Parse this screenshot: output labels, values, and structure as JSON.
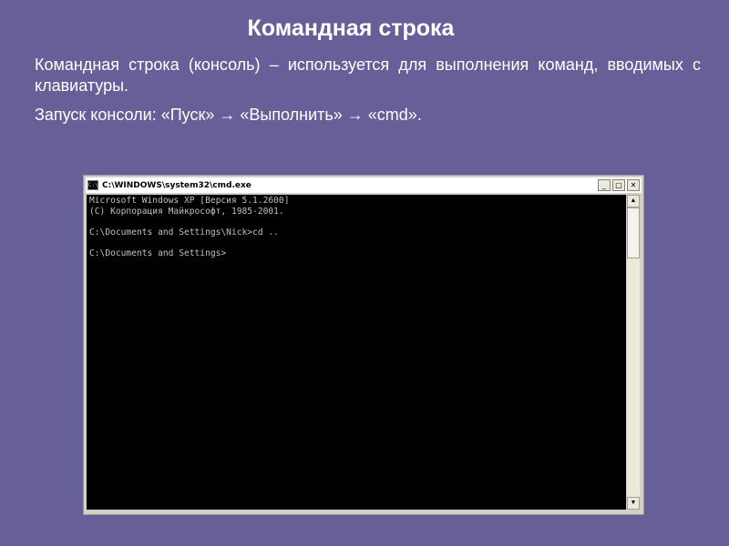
{
  "slide": {
    "title": "Командная строка",
    "paragraph1": "Командная строка (консоль) – используется для выполнения команд, вводимых с клавиатуры.",
    "paragraph2": "Запуск консоли: «Пуск» → «Выполнить» → «cmd»."
  },
  "window": {
    "title": "C:\\WINDOWS\\system32\\cmd.exe",
    "icon": "cmd-icon",
    "controls": {
      "minimize": "_",
      "maximize": "□",
      "close": "✕"
    },
    "console_lines": [
      "Microsoft Windows XP [Версия 5.1.2600]",
      "(С) Корпорация Майкрософт, 1985-2001.",
      "",
      "C:\\Documents and Settings\\Nick>cd ..",
      "",
      "C:\\Documents and Settings>"
    ],
    "scroll_arrows": {
      "up": "▲",
      "down": "▼"
    }
  },
  "colors": {
    "slide_background": "#676098",
    "console_background": "#000000",
    "console_text": "#c0c0c0"
  }
}
